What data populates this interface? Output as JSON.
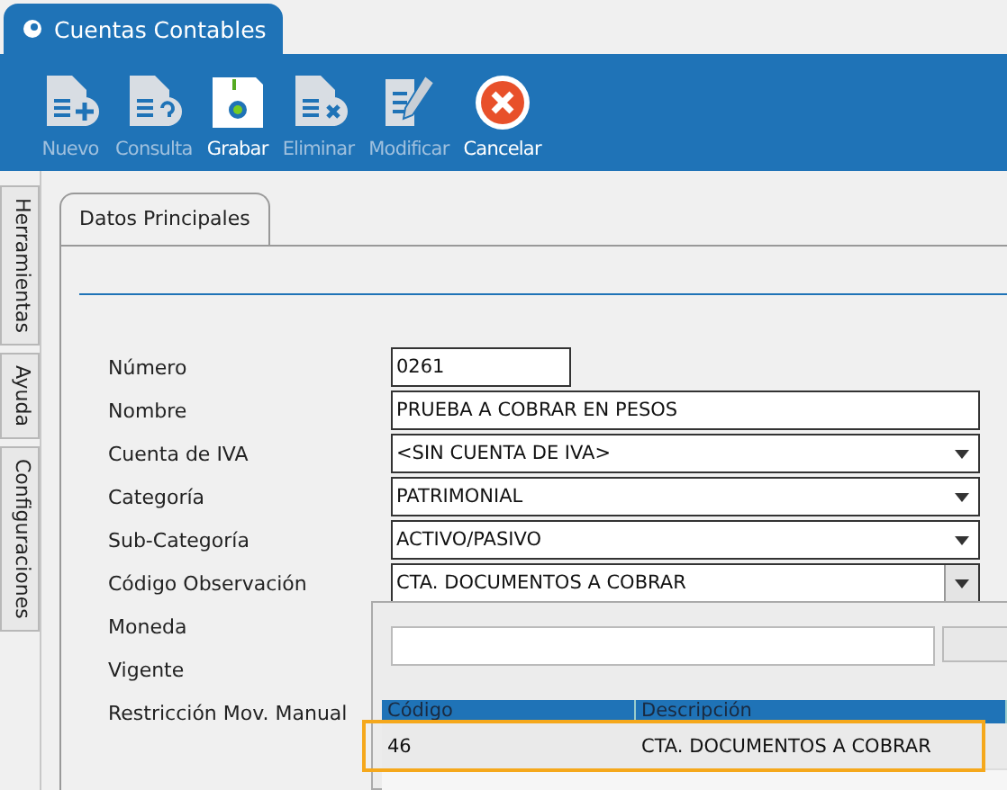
{
  "window": {
    "title": "Cuentas Contables"
  },
  "toolbar": [
    {
      "label": "Nuevo",
      "kind": "new",
      "disabled": true
    },
    {
      "label": "Consulta",
      "kind": "query",
      "disabled": true
    },
    {
      "label": "Grabar",
      "kind": "save",
      "disabled": false
    },
    {
      "label": "Eliminar",
      "kind": "delete",
      "disabled": true
    },
    {
      "label": "Modificar",
      "kind": "edit",
      "disabled": true
    },
    {
      "label": "Cancelar",
      "kind": "cancel",
      "disabled": false
    }
  ],
  "side_tabs": [
    "Herramientas",
    "Ayuda",
    "Configuraciones"
  ],
  "tabs": [
    {
      "label": "Datos Principales",
      "selected": true
    }
  ],
  "form": [
    {
      "label": "Número",
      "kind": "code",
      "value": "0261"
    },
    {
      "label": "Nombre",
      "kind": "text",
      "value": "PRUEBA A COBRAR EN PESOS"
    },
    {
      "label": "Cuenta de IVA",
      "kind": "select",
      "value": "<SIN CUENTA DE IVA>"
    },
    {
      "label": "Categoría",
      "kind": "select",
      "value": "PATRIMONIAL"
    },
    {
      "label": "Sub-Categoría",
      "kind": "select",
      "value": "ACTIVO/PASIVO"
    },
    {
      "label": "Código Observación",
      "kind": "select",
      "value": "CTA. DOCUMENTOS A COBRAR",
      "expanded": true
    },
    {
      "label": "Moneda",
      "kind": "hidden"
    },
    {
      "label": "Vigente",
      "kind": "hidden"
    },
    {
      "label": "Restricción Mov. Manual",
      "kind": "hidden"
    }
  ],
  "dropdown": {
    "columns": [
      "Código",
      "Descripción"
    ],
    "rows": [
      {
        "cells": [
          "46",
          "CTA. DOCUMENTOS A COBRAR"
        ],
        "selected": true
      },
      {
        "cells": [],
        "selected": false
      }
    ]
  }
}
